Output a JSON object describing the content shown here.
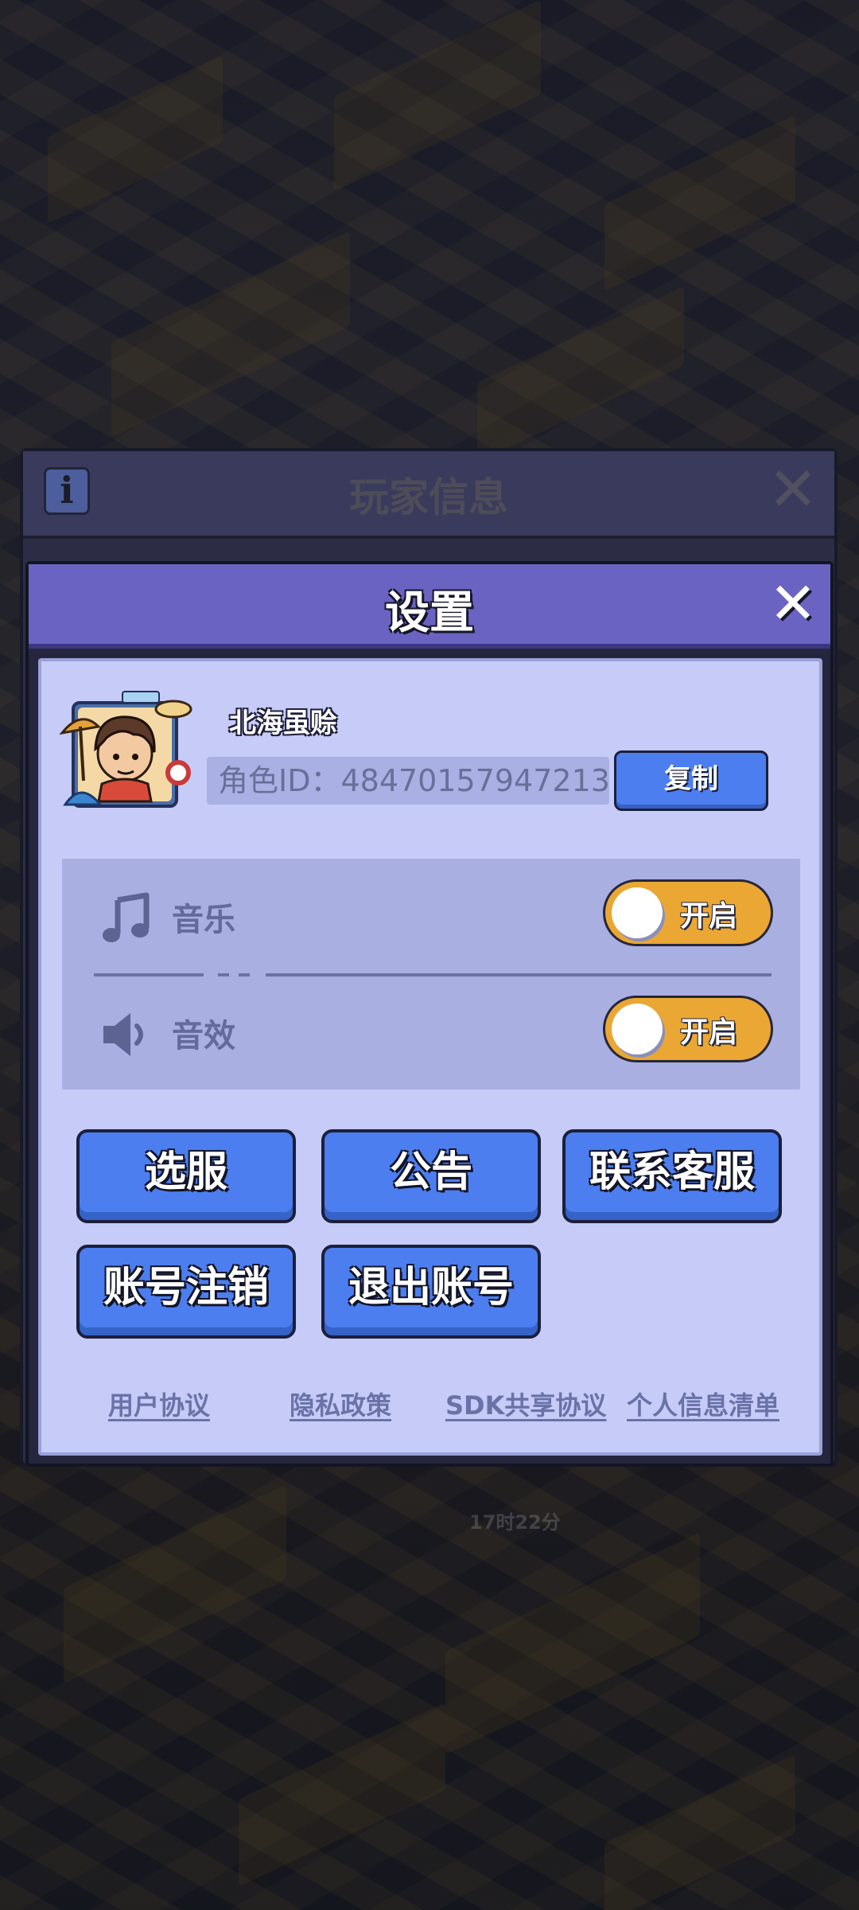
{
  "background": {
    "timer": "17时22分"
  },
  "player_panel": {
    "title": "玩家信息",
    "info_icon": "info-icon",
    "close_icon": "close-icon"
  },
  "settings": {
    "title": "设置",
    "close_symbol": "✕",
    "profile": {
      "nickname": "北海虽赊",
      "role_id": "角色ID：48470157947213",
      "copy_label": "复制"
    },
    "audio": {
      "music_label": "音乐",
      "music_state": "开启",
      "music_icon": "music-note-icon",
      "sfx_label": "音效",
      "sfx_state": "开启",
      "sfx_icon": "speaker-icon"
    },
    "buttons": {
      "select_server": "选服",
      "announcement": "公告",
      "contact_support": "联系客服",
      "delete_account": "账号注销",
      "logout": "退出账号"
    },
    "links": {
      "user_agreement": "用户协议",
      "privacy_policy": "隐私政策",
      "sdk_agreement": "SDK共享协议",
      "personal_info_list": "个人信息清单"
    }
  },
  "colors": {
    "dialog_header": "#6b63c2",
    "dialog_body": "#c6cbf7",
    "primary_button": "#4c7ef0",
    "toggle_on": "#eaa733"
  }
}
